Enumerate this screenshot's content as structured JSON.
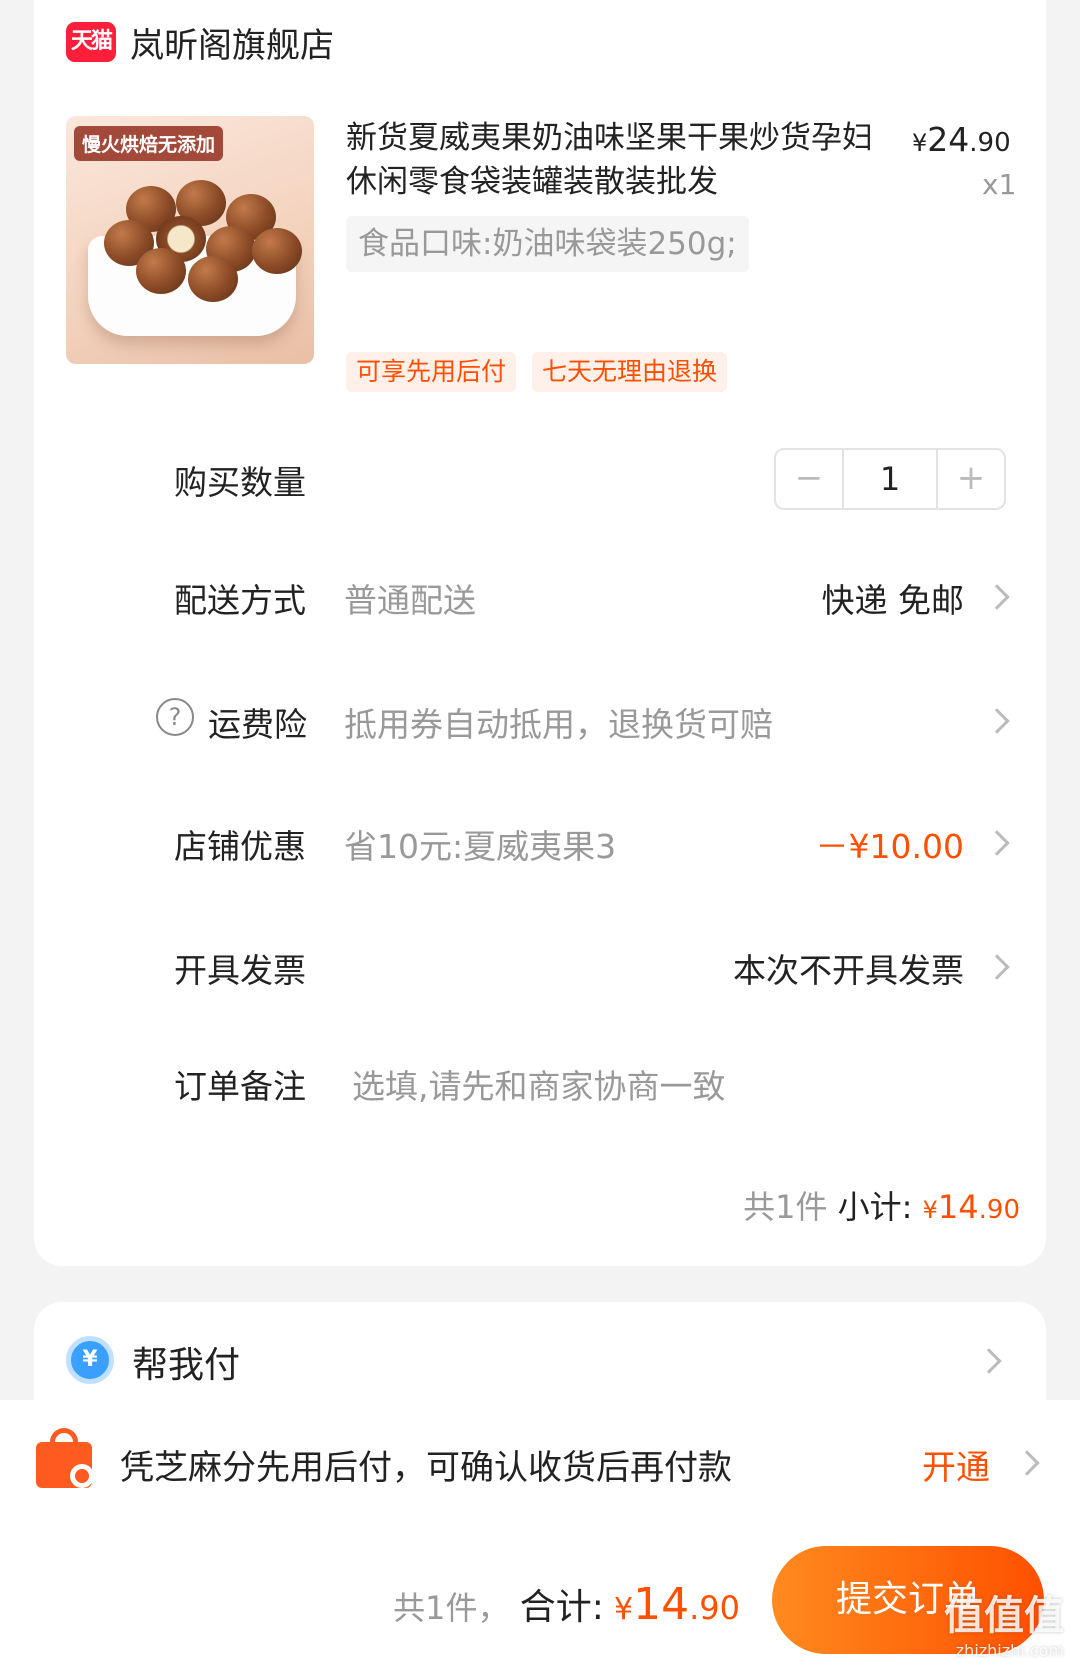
{
  "store": {
    "logo_text": "天猫",
    "name": "岚昕阁旗舰店"
  },
  "product": {
    "image_badge": "慢火烘焙无添加",
    "title": "新货夏威夷果奶油味坚果干果炒货孕妇休闲零食袋装罐装散装批发",
    "price_symbol": "¥",
    "price_int": "24",
    "price_dec": ".90",
    "quantity_label": "x1",
    "sku": "食品口味:奶油味袋装250g;",
    "tags": [
      "可享先用后付",
      "七天无理由退换"
    ]
  },
  "rows": {
    "quantity": {
      "label": "购买数量",
      "minus": "−",
      "value": "1",
      "plus": "+"
    },
    "delivery": {
      "label": "配送方式",
      "sub": "普通配送",
      "right": "快递 免邮"
    },
    "insurance": {
      "icon": "?",
      "label": "运费险",
      "sub": "抵用券自动抵用，退换货可赔"
    },
    "discount": {
      "label": "店铺优惠",
      "sub": "省10元:夏威夷果3",
      "right": "－¥10.00"
    },
    "invoice": {
      "label": "开具发票",
      "right": "本次不开具发票"
    },
    "note": {
      "label": "订单备注",
      "placeholder": "选填,请先和商家协商一致"
    }
  },
  "subtotal": {
    "count": "共1件",
    "label": "小计:",
    "symbol": "¥",
    "int": "14",
    "dec": ".90"
  },
  "help_pay": {
    "icon": "¥",
    "label": "帮我付"
  },
  "promo": {
    "text": "凭芝麻分先用后付，可确认收货后再付款",
    "link": "开通"
  },
  "footer": {
    "count": "共1件，",
    "label": "合计:",
    "symbol": "¥",
    "int": "14",
    "dec": ".90",
    "submit": "提交订单"
  },
  "watermark": {
    "text": "值值值",
    "url": "zhizhizhi.com"
  },
  "colors": {
    "accent": "#ff5000",
    "tmall_red": "#ff1f3a",
    "muted": "#999999"
  }
}
